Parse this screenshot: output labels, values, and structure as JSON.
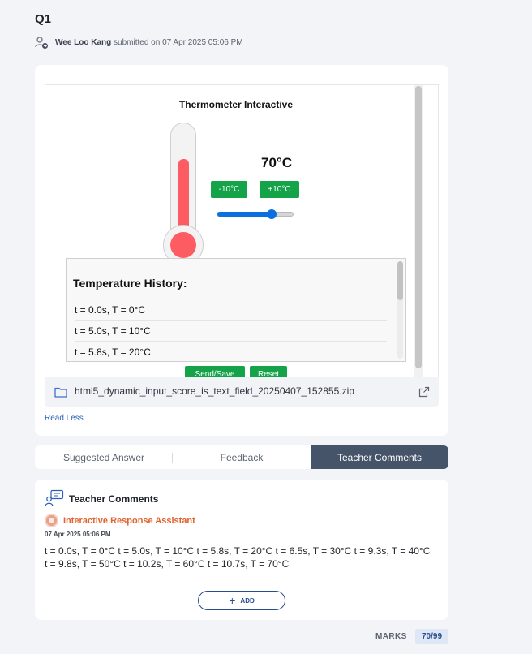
{
  "question": {
    "title": "Q1"
  },
  "submission": {
    "user": "Wee Loo Kang",
    "text": "submitted on 07 Apr 2025 05:06 PM"
  },
  "sim": {
    "title": "Thermometer Interactive",
    "temperature": "70°C",
    "temperature_value": 70,
    "minus_label": "-10°C",
    "plus_label": "+10°C",
    "slider_fraction": 0.7,
    "history_title": "Temperature History:",
    "history": [
      "t = 0.0s, T = 0°C",
      "t = 5.0s, T = 10°C",
      "t = 5.8s, T = 20°C"
    ],
    "send_label": "Send/Save",
    "reset_label": "Reset",
    "colors": {
      "mercury": "#fd5c63",
      "button": "#15a34a",
      "slider": "#0b6fe0"
    }
  },
  "attachment": {
    "filename": "html5_dynamic_input_score_is_text_field_20250407_152855.zip",
    "icon": "folder-icon",
    "action_icon": "external-link-icon"
  },
  "read_less": "Read Less",
  "tabs": [
    {
      "label": "Suggested Answer",
      "active": false
    },
    {
      "label": "Feedback",
      "active": false
    },
    {
      "label": "Teacher Comments",
      "active": true
    }
  ],
  "comments": {
    "header": "Teacher Comments",
    "author": "Interactive Response Assistant",
    "date": "07 Apr 2025 05:06 PM",
    "body": "t = 0.0s, T = 0°C t = 5.0s, T = 10°C t = 5.8s, T = 20°C t = 6.5s, T = 30°C t = 9.3s, T = 40°C t = 9.8s, T = 50°C t = 10.2s, T = 60°C t = 10.7s, T = 70°C",
    "add_label": "ADD"
  },
  "marks": {
    "label": "MARKS",
    "value": "70/99"
  }
}
